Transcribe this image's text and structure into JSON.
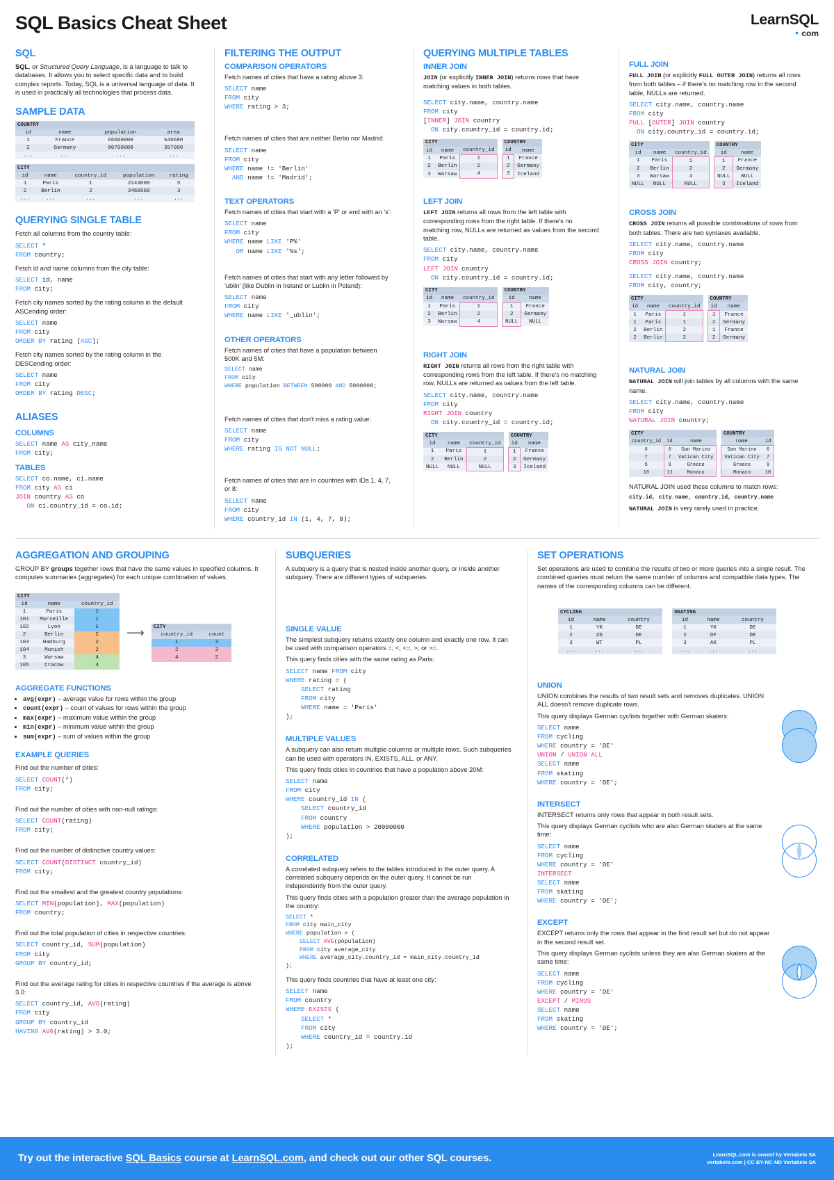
{
  "header": {
    "title": "SQL Basics Cheat Sheet",
    "logo_main": "LearnSQL",
    "logo_dot": "•",
    "logo_sub": "com"
  },
  "sql": {
    "heading": "SQL",
    "body_pre": "SQL",
    "body_em": ", or Structured Query Language",
    "body_rest": ", is a language to talk to databases. It allows you to select specific data and to build complex reports. Today, SQL is a universal language of data. It is used in practically all technologies that process data."
  },
  "sample_data": {
    "heading": "SAMPLE DATA",
    "country": {
      "name": "COUNTRY",
      "columns": [
        "id",
        "name",
        "population",
        "area"
      ],
      "rows": [
        [
          "1",
          "France",
          "66600000",
          "640680"
        ],
        [
          "2",
          "Germany",
          "80700000",
          "357000"
        ],
        [
          "...",
          "...",
          "...",
          "..."
        ]
      ]
    },
    "city": {
      "name": "CITY",
      "columns": [
        "id",
        "name",
        "country_id",
        "population",
        "rating"
      ],
      "rows": [
        [
          "1",
          "Paris",
          "1",
          "2243000",
          "5"
        ],
        [
          "2",
          "Berlin",
          "2",
          "3460000",
          "3"
        ],
        [
          "...",
          "...",
          "...",
          "...",
          "..."
        ]
      ]
    }
  },
  "querying_single": {
    "heading": "QUERYING SINGLE TABLE",
    "items": [
      {
        "desc": "Fetch all columns from the country table:",
        "code": "SELECT *\nFROM country;"
      },
      {
        "desc": "Fetch id and name columns from the city table:",
        "code": "SELECT id, name\nFROM city;"
      },
      {
        "desc": "Fetch city names sorted by the rating column in the default ASCending order:",
        "code": "SELECT name\nFROM city\nORDER BY rating [ASC];"
      },
      {
        "desc": "Fetch city names sorted by the rating column in the DESCending order:",
        "code": "SELECT name\nFROM city\nORDER BY rating DESC;"
      }
    ]
  },
  "aliases": {
    "heading": "ALIASES",
    "columns_label": "COLUMNS",
    "columns_code": "SELECT name AS city_name\nFROM city;",
    "tables_label": "TABLES",
    "tables_code": "SELECT co.name, ci.name\nFROM city AS ci\nJOIN country AS co\n   ON ci.country_id = co.id;"
  },
  "filtering": {
    "heading": "FILTERING THE OUTPUT",
    "comparison_label": "COMPARISON OPERATORS",
    "comparison": [
      {
        "desc": "Fetch names of cities that have a rating above 3:",
        "code": "SELECT name\nFROM city\nWHERE rating > 3;"
      },
      {
        "desc": "Fetch names of cities that are neither Berlin nor Madrid:",
        "code": "SELECT name\nFROM city\nWHERE name != 'Berlin'\n  AND name != 'Madrid';"
      }
    ],
    "text_label": "TEXT OPERATORS",
    "text_ops": [
      {
        "desc": "Fetch names of cities that start with a 'P' or end with an 's':",
        "code": "SELECT name\nFROM city\nWHERE name LIKE 'P%'\n   OR name LIKE '%s';"
      },
      {
        "desc": "Fetch names of cities that start with any letter followed by 'ublin' (like Dublin in Ireland or Lublin in Poland):",
        "code": "SELECT name\nFROM city\nWHERE name LIKE '_ublin';"
      }
    ],
    "other_label": "OTHER OPERATORS",
    "other_ops": [
      {
        "desc": "Fetch names of cities that have a population between 500K and 5M:",
        "code": "SELECT name\nFROM city\nWHERE population BETWEEN 500000 AND 5000000;"
      },
      {
        "desc": "Fetch names of cities that don't miss a rating value:",
        "code": "SELECT name\nFROM city\nWHERE rating IS NOT NULL;"
      },
      {
        "desc": "Fetch names of cities that are in countries with IDs 1, 4, 7, or 8:",
        "code": "SELECT name\nFROM city\nWHERE country_id IN (1, 4, 7, 8);"
      }
    ]
  },
  "querying_multiple": {
    "heading": "QUERYING MULTIPLE TABLES",
    "inner": {
      "label": "INNER JOIN",
      "desc_mono1": "JOIN",
      "desc_mid": " (or explicitly ",
      "desc_mono2": "INNER JOIN",
      "desc_end": ") returns rows that have matching values in both tables.",
      "code": "SELECT city.name, country.name\nFROM city\n[INNER] JOIN country\n  ON city.country_id = country.id;",
      "city": {
        "name": "CITY",
        "columns": [
          "id",
          "name",
          "country_id"
        ],
        "rows": [
          [
            "1",
            "Paris",
            "1"
          ],
          [
            "2",
            "Berlin",
            "2"
          ],
          [
            "3",
            "Warsaw",
            "4"
          ]
        ]
      },
      "country": {
        "name": "COUNTRY",
        "columns": [
          "id",
          "name"
        ],
        "rows": [
          [
            "1",
            "France"
          ],
          [
            "2",
            "Germany"
          ],
          [
            "3",
            "Iceland"
          ]
        ]
      }
    },
    "left": {
      "label": "LEFT JOIN",
      "desc_mono": "LEFT JOIN",
      "desc": " returns all rows from the left table with corresponding rows from the right table. If there's no matching row, NULLs are returned as values from the second table.",
      "code": "SELECT city.name, country.name\nFROM city\nLEFT JOIN country\n  ON city.country_id = country.id;",
      "city": {
        "name": "CITY",
        "columns": [
          "id",
          "name",
          "country_id"
        ],
        "rows": [
          [
            "1",
            "Paris",
            "1"
          ],
          [
            "2",
            "Berlin",
            "2"
          ],
          [
            "3",
            "Warsaw",
            "4"
          ]
        ]
      },
      "country": {
        "name": "COUNTRY",
        "columns": [
          "id",
          "name"
        ],
        "rows": [
          [
            "1",
            "France"
          ],
          [
            "2",
            "Germany"
          ],
          [
            "NULL",
            "NULL"
          ]
        ]
      }
    },
    "right": {
      "label": "RIGHT JOIN",
      "desc_mono": "RIGHT JOIN",
      "desc": " returns all rows from the right table with corresponding rows from the left table. If there's no matching row, NULLs are returned as values from the left table.",
      "code": "SELECT city.name, country.name\nFROM city\nRIGHT JOIN country\n  ON city.country_id = country.id;",
      "city": {
        "name": "CITY",
        "columns": [
          "id",
          "name",
          "country_id"
        ],
        "rows": [
          [
            "1",
            "Paris",
            "1"
          ],
          [
            "2",
            "Berlin",
            "2"
          ],
          [
            "NULL",
            "NULL",
            "NULL"
          ]
        ]
      },
      "country": {
        "name": "COUNTRY",
        "columns": [
          "id",
          "name"
        ],
        "rows": [
          [
            "1",
            "France"
          ],
          [
            "2",
            "Germany"
          ],
          [
            "3",
            "Iceland"
          ]
        ]
      }
    },
    "full": {
      "label": "FULL JOIN",
      "desc_mono1": "FULL JOIN",
      "desc_mid": " (or explicitly ",
      "desc_mono2": "FULL OUTER JOIN",
      "desc_end": ") returns all rows from both tables – if there's no matching row in the second table, NULLs are returned.",
      "code": "SELECT city.name, country.name\nFROM city\nFULL [OUTER] JOIN country\n  ON city.country_id = country.id;",
      "city": {
        "name": "CITY",
        "columns": [
          "id",
          "name",
          "country_id"
        ],
        "rows": [
          [
            "1",
            "Paris",
            "1"
          ],
          [
            "2",
            "Berlin",
            "2"
          ],
          [
            "3",
            "Warsaw",
            "4"
          ],
          [
            "NULL",
            "NULL",
            "NULL"
          ]
        ]
      },
      "country": {
        "name": "COUNTRY",
        "columns": [
          "id",
          "name"
        ],
        "rows": [
          [
            "1",
            "France"
          ],
          [
            "2",
            "Germany"
          ],
          [
            "NULL",
            "NULL"
          ],
          [
            "3",
            "Iceland"
          ]
        ]
      }
    },
    "cross": {
      "label": "CROSS JOIN",
      "desc_mono": "CROSS JOIN",
      "desc": " returns all possible combinations of rows from both tables. There are two syntaxes available.",
      "code1": "SELECT city.name, country.name\nFROM city\nCROSS JOIN country;",
      "code2": "SELECT city.name, country.name\nFROM city, country;",
      "city": {
        "name": "CITY",
        "columns": [
          "id",
          "name",
          "country_id"
        ],
        "rows": [
          [
            "1",
            "Paris",
            "1"
          ],
          [
            "1",
            "Paris",
            "1"
          ],
          [
            "2",
            "Berlin",
            "2"
          ],
          [
            "2",
            "Berlin",
            "2"
          ]
        ]
      },
      "country": {
        "name": "COUNTRY",
        "columns": [
          "id",
          "name"
        ],
        "rows": [
          [
            "1",
            "France"
          ],
          [
            "2",
            "Germany"
          ],
          [
            "1",
            "France"
          ],
          [
            "2",
            "Germany"
          ]
        ]
      }
    },
    "natural": {
      "label": "NATURAL JOIN",
      "desc_mono": "NATURAL JOIN",
      "desc": " will join tables by all columns with the same name.",
      "code": "SELECT city.name, country.name\nFROM city\nNATURAL JOIN country;",
      "city": {
        "name": "CITY",
        "columns": [
          "country_id",
          "id",
          "name"
        ],
        "rows": [
          [
            "6",
            "6",
            "San Marino"
          ],
          [
            "7",
            "7",
            "Vatican City"
          ],
          [
            "5",
            "9",
            "Greece"
          ],
          [
            "10",
            "11",
            "Monaco"
          ]
        ]
      },
      "country": {
        "name": "COUNTRY",
        "columns": [
          "name",
          "id"
        ],
        "rows": [
          [
            "San Marino",
            "6"
          ],
          [
            "Vatican City",
            "7"
          ],
          [
            "Greece",
            "9"
          ],
          [
            "Monaco",
            "10"
          ]
        ]
      },
      "note1": "NATURAL JOIN used these columns to match rows:",
      "note2": "city.id, city.name, country.id, country.name",
      "note3": "NATURAL JOIN is very rarely used in practice."
    }
  },
  "aggregation": {
    "heading": "AGGREGATION AND GROUPING",
    "desc_pre": "GROUP  BY ",
    "desc_bold": "groups",
    "desc_post": " together rows that have the same values in specified columns. It computes summaries (aggregates) for each unique combination of values.",
    "city_table": {
      "name": "CITY",
      "columns": [
        "id",
        "name",
        "country_id"
      ],
      "rows": [
        [
          "1",
          "Paris",
          "1",
          "blue"
        ],
        [
          "101",
          "Marseille",
          "1",
          "blue"
        ],
        [
          "102",
          "Lyon",
          "1",
          "blue"
        ],
        [
          "2",
          "Berlin",
          "2",
          "orange"
        ],
        [
          "103",
          "Hamburg",
          "2",
          "orange"
        ],
        [
          "104",
          "Munich",
          "2",
          "orange"
        ],
        [
          "3",
          "Warsaw",
          "4",
          "green"
        ],
        [
          "105",
          "Cracow",
          "4",
          "green"
        ]
      ]
    },
    "result_table": {
      "name": "CITY",
      "columns": [
        "country_id",
        "count"
      ],
      "rows": [
        [
          "1",
          "3",
          "blue"
        ],
        [
          "2",
          "3",
          "pink"
        ],
        [
          "4",
          "2",
          "pink"
        ]
      ]
    },
    "functions_label": "AGGREGATE FUNCTIONS",
    "functions": [
      {
        "fn": "avg(expr)",
        "desc": " – average value for rows within the group"
      },
      {
        "fn": "count(expr)",
        "desc": " – count of values for rows within the group"
      },
      {
        "fn": "max(expr)",
        "desc": " – maximum value within the group"
      },
      {
        "fn": "min(expr)",
        "desc": " – minimum value within the group"
      },
      {
        "fn": "sum(expr)",
        "desc": " – sum of values within the group"
      }
    ],
    "examples_label": "EXAMPLE QUERIES",
    "examples": [
      {
        "desc": "Find out the number of cities:",
        "code": "SELECT COUNT(*)\nFROM city;"
      },
      {
        "desc": "Find out the number of cities with non-null ratings:",
        "code": "SELECT COUNT(rating)\nFROM city;"
      },
      {
        "desc": "Find out the number of distinctive country values:",
        "code": "SELECT COUNT(DISTINCT country_id)\nFROM city;"
      },
      {
        "desc": "Find out the smallest and the greatest country populations:",
        "code": "SELECT MIN(population), MAX(population)\nFROM country;"
      },
      {
        "desc": "Find out the total population of cities in respective countries:",
        "code": "SELECT country_id, SUM(population)\nFROM city\nGROUP BY country_id;"
      },
      {
        "desc": "Find out the average rating for cities in respective countries if the average is above 3.0:",
        "code": "SELECT country_id, AVG(rating)\nFROM city\nGROUP BY country_id\nHAVING AVG(rating) > 3.0;"
      }
    ]
  },
  "subqueries": {
    "heading": "SUBQUERIES",
    "desc": "A subquery is a query that is nested inside another query, or inside another subquery. There are different types of subqueries.",
    "single_label": "SINGLE VALUE",
    "single_desc1": "The simplest subquery returns exactly one column and exactly one row. It can be used with comparison operators =, <, <=, >, or >=.",
    "single_desc2": "This query finds cities with the same rating as Paris:",
    "single_code": "SELECT name FROM city\nWHERE rating = (\n    SELECT rating\n    FROM city\n    WHERE name = 'Paris'\n);",
    "multiple_label": "MULTIPLE VALUES",
    "multiple_desc1": "A subquery can also return multiple columns or multiple rows. Such subqueries can be used with operators IN, EXISTS, ALL, or ANY.",
    "multiple_desc2": "This query finds cities in countries that have a population above 20M:",
    "multiple_code": "SELECT name\nFROM city\nWHERE country_id IN (\n    SELECT country_id\n    FROM country\n    WHERE population > 20000000\n);",
    "correlated_label": "CORRELATED",
    "correlated_desc1": "A correlated subquery refers to the tables introduced in the outer query. A correlated subquery depends on the outer query. It cannot be run independently from the outer query.",
    "correlated_desc2": "This query finds cities with a population greater than the average population in the country:",
    "correlated_code": "SELECT *\nFROM city main_city\nWHERE population > (\n    SELECT AVG(population)\n    FROM city average_city\n    WHERE average_city.country_id = main_city.country_id\n);",
    "correlated_desc3": "This query finds countries that have at least one city:",
    "correlated_code2": "SELECT name\nFROM country\nWHERE EXISTS (\n    SELECT *\n    FROM city\n    WHERE country_id = country.id\n);"
  },
  "set_operations": {
    "heading": "SET OPERATIONS",
    "desc": "Set operations are used to combine the results of two or more queries into a single result. The combined queries must return the same number of columns and compatible data types. The names of the corresponding columns can be different.",
    "cycling": {
      "name": "CYCLING",
      "columns": [
        "id",
        "name",
        "country"
      ],
      "rows": [
        [
          "1",
          "YK",
          "DE"
        ],
        [
          "2",
          "ZG",
          "DE"
        ],
        [
          "3",
          "WT",
          "PL"
        ],
        [
          "...",
          "...",
          "..."
        ]
      ]
    },
    "skating": {
      "name": "SKATING",
      "columns": [
        "id",
        "name",
        "country"
      ],
      "rows": [
        [
          "1",
          "YK",
          "DE"
        ],
        [
          "2",
          "DF",
          "DE"
        ],
        [
          "3",
          "AK",
          "PL"
        ],
        [
          "...",
          "...",
          "..."
        ]
      ]
    },
    "union": {
      "label": "UNION",
      "desc": "UNION combines the results of two result sets and removes duplicates. UNION  ALL doesn't remove duplicate rows.",
      "desc2": "This query displays German cyclists together with German skaters:",
      "code": "SELECT name\nFROM cycling\nWHERE country = 'DE'\nUNION / UNION ALL\nSELECT name\nFROM skating\nWHERE country = 'DE';",
      "venn": "both-filled"
    },
    "intersect": {
      "label": "INTERSECT",
      "desc": "INTERSECT returns only rows that appear in both result sets.",
      "desc2": "This query displays German cyclists who are also German skaters at the same time:",
      "code": "SELECT name\nFROM cycling\nWHERE country = 'DE'\nINTERSECT\nSELECT name\nFROM skating\nWHERE country = 'DE';",
      "venn": "overlap-filled"
    },
    "except": {
      "label": "EXCEPT",
      "desc": "EXCEPT returns only the rows that appear in the first result set but do not appear in the second result set.",
      "desc2": "This query displays German cyclists unless they are also German skaters at the same time:",
      "code": "SELECT name\nFROM cycling\nWHERE country = 'DE'\nEXCEPT / MINUS\nSELECT name\nFROM skating\nWHERE country = 'DE';",
      "venn": "first-filled"
    }
  },
  "footer": {
    "text_pre": "Try out the interactive ",
    "link1": "SQL Basics",
    "text_mid": " course at ",
    "link2": "LearnSQL.com",
    "text_post": ", and check out our other SQL courses.",
    "right_line1": "LearnSQL.com is owned by Vertabelo SA",
    "right_line2": "vertabelo.com | CC BY-NC-ND Vertabelo SA"
  },
  "colors": {
    "accent": "#2b8cf0",
    "magenta": "#e5308a",
    "highlight": "#ec82b5"
  }
}
